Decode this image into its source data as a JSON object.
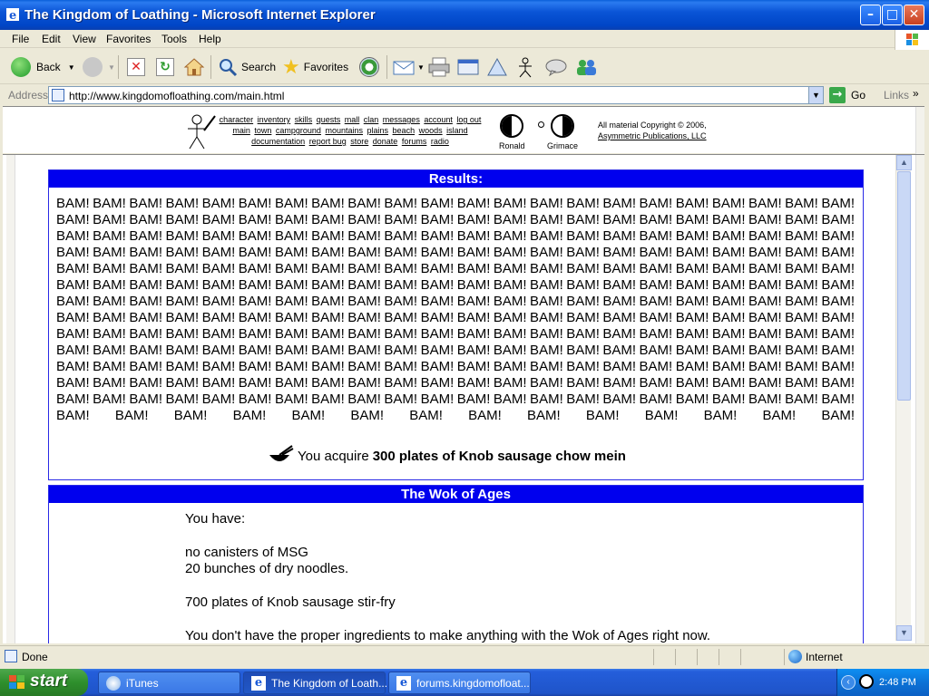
{
  "window": {
    "title": "The Kingdom of Loathing - Microsoft Internet Explorer",
    "minimize": "–",
    "maximize": "□",
    "close": "✕"
  },
  "menu": [
    "File",
    "Edit",
    "View",
    "Favorites",
    "Tools",
    "Help"
  ],
  "toolbar": {
    "back_label": "Back",
    "search_label": "Search",
    "favorites_label": "Favorites"
  },
  "address": {
    "label": "Address",
    "url": "http://www.kingdomofloathing.com/main.html",
    "go_label": "Go",
    "links_label": "Links"
  },
  "top_nav": {
    "row1": [
      "character",
      "inventory",
      "skills",
      "quests",
      "mall",
      "clan",
      "messages",
      "account",
      "log out"
    ],
    "row2": [
      "main",
      "town",
      "campground",
      "mountains",
      "plains",
      "beach",
      "woods",
      "island"
    ],
    "row3": [
      "documentation",
      "report bug",
      "store",
      "donate",
      "forums",
      "radio"
    ],
    "moon1": "Ronald",
    "moon2": "Grimace",
    "copyright_line1": "All material Copyright © 2006,",
    "copyright_line2": "Asymmetric Publications, LLC"
  },
  "results": {
    "header": "Results:",
    "bam_word": "BAM!",
    "bam_count": 300,
    "acquire_prefix": "You acquire",
    "acquire_item": "300 plates of Knob sausage chow mein"
  },
  "wok": {
    "header": "The Wok of Ages",
    "you_have": "You have:",
    "line_msg": "no canisters of MSG",
    "line_noodles": "20 bunches of dry noodles.",
    "line_stirfry": "700 plates of Knob sausage stir-fry",
    "line_none": "You don't have the proper ingredients to make anything with the Wok of Ages right now."
  },
  "statusbar": {
    "status": "Done",
    "zone": "Internet"
  },
  "taskbar": {
    "start": "start",
    "tasks": [
      "iTunes",
      "The Kingdom of Loath...",
      "forums.kingdomofloat..."
    ],
    "clock": "2:48 PM"
  },
  "colors": {
    "panel_header": "#0000ee",
    "panel_border": "#2a2ae6",
    "titlebar": "#0a54d6",
    "taskbar": "#245edb",
    "start": "#2e8f2c"
  }
}
